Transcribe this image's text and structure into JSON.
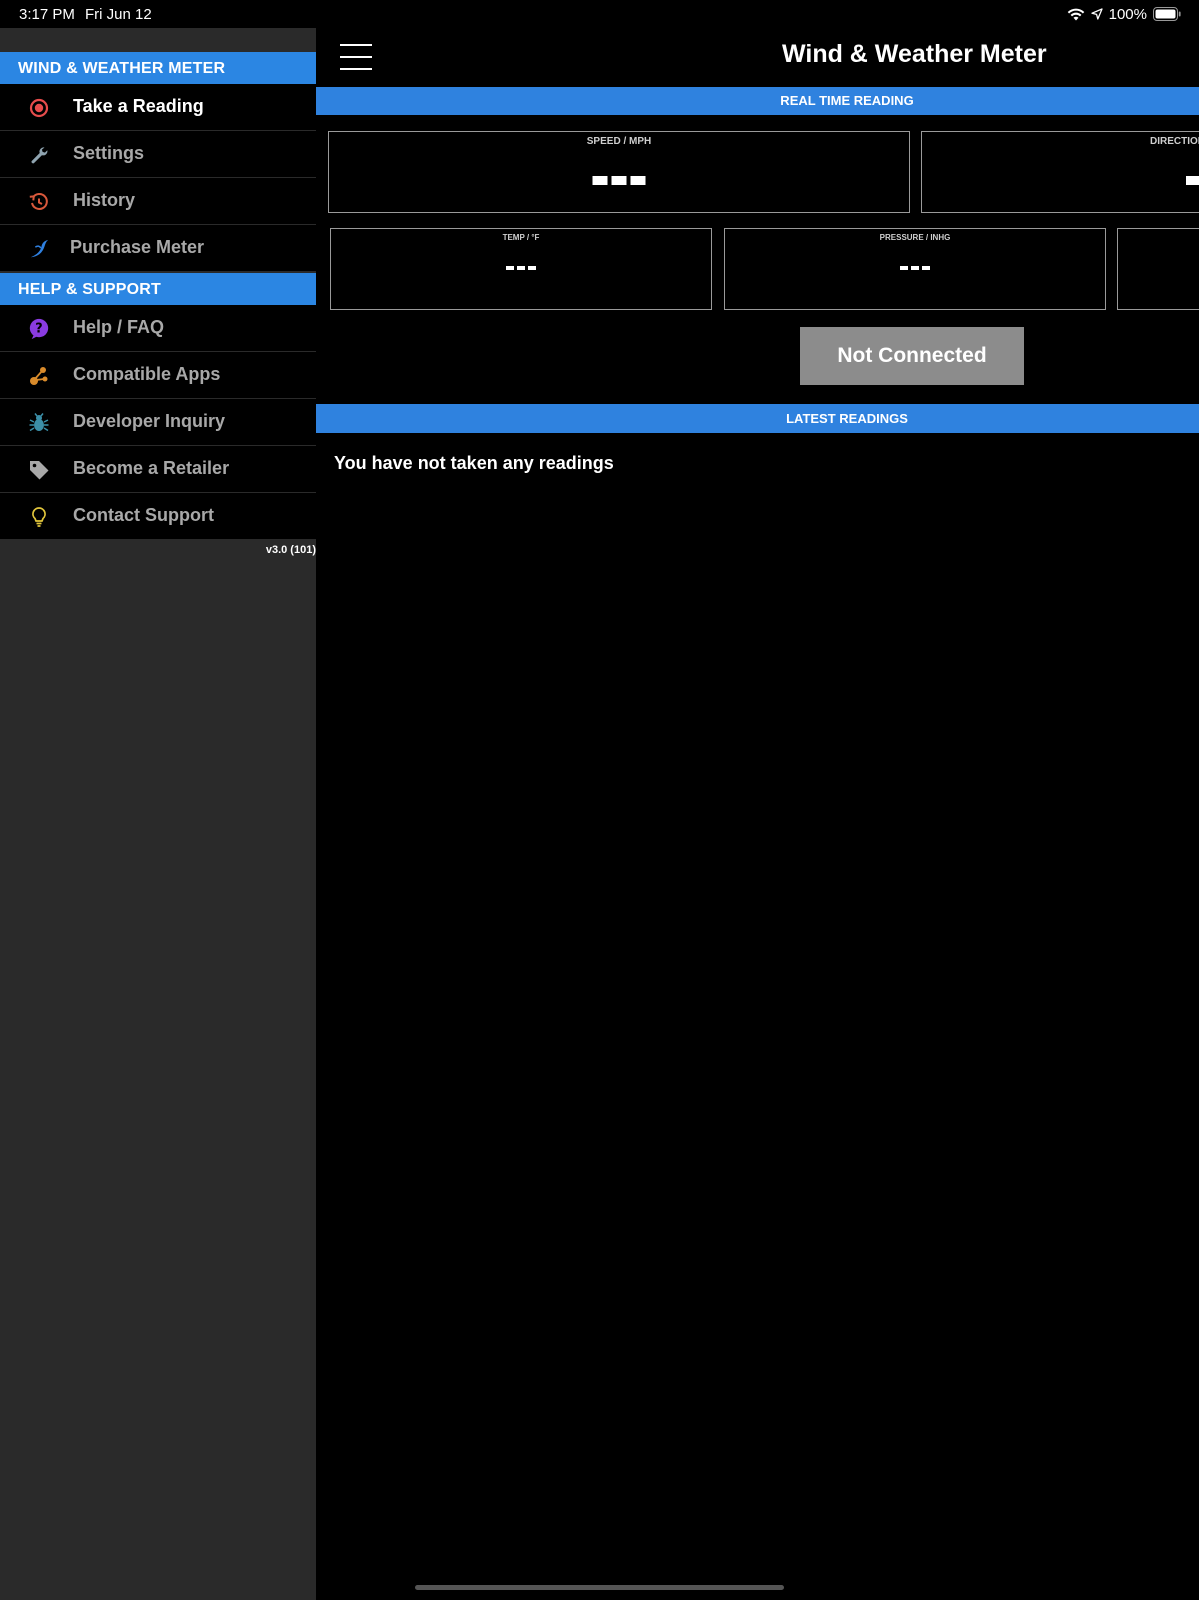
{
  "status_bar": {
    "time": "3:17 PM",
    "date": "Fri Jun 12",
    "battery": "100%"
  },
  "sidebar": {
    "sections": [
      {
        "title": "WIND & WEATHER METER",
        "items": [
          {
            "label": "Take a Reading",
            "icon": "record-icon",
            "active": true
          },
          {
            "label": "Settings",
            "icon": "wrench-icon"
          },
          {
            "label": "History",
            "icon": "history-icon"
          },
          {
            "label": "Purchase Meter",
            "icon": "bird-logo-icon"
          }
        ]
      },
      {
        "title": "HELP & SUPPORT",
        "items": [
          {
            "label": "Help / FAQ",
            "icon": "question-icon"
          },
          {
            "label": "Compatible Apps",
            "icon": "share-nodes-icon"
          },
          {
            "label": "Developer Inquiry",
            "icon": "bug-icon"
          },
          {
            "label": "Become a Retailer",
            "icon": "tag-icon"
          },
          {
            "label": "Contact Support",
            "icon": "lightbulb-icon"
          }
        ]
      }
    ],
    "version": "v3.0 (101)"
  },
  "header": {
    "title": "Wind & Weather Meter"
  },
  "realtime": {
    "band_title": "REAL TIME READING",
    "speed_label": "SPEED / MPH",
    "direction_label": "DIRECTION",
    "temp_label": "TEMP / °F",
    "pressure_label": "PRESSURE / INHG"
  },
  "connect_button": "Not Connected",
  "latest": {
    "band_title": "LATEST READINGS",
    "empty_message": "You have not taken any readings"
  },
  "colors": {
    "accent_blue": "#2b86e3",
    "button_gray": "#8c8c8c",
    "sidebar_bg": "#2a2a2a"
  }
}
